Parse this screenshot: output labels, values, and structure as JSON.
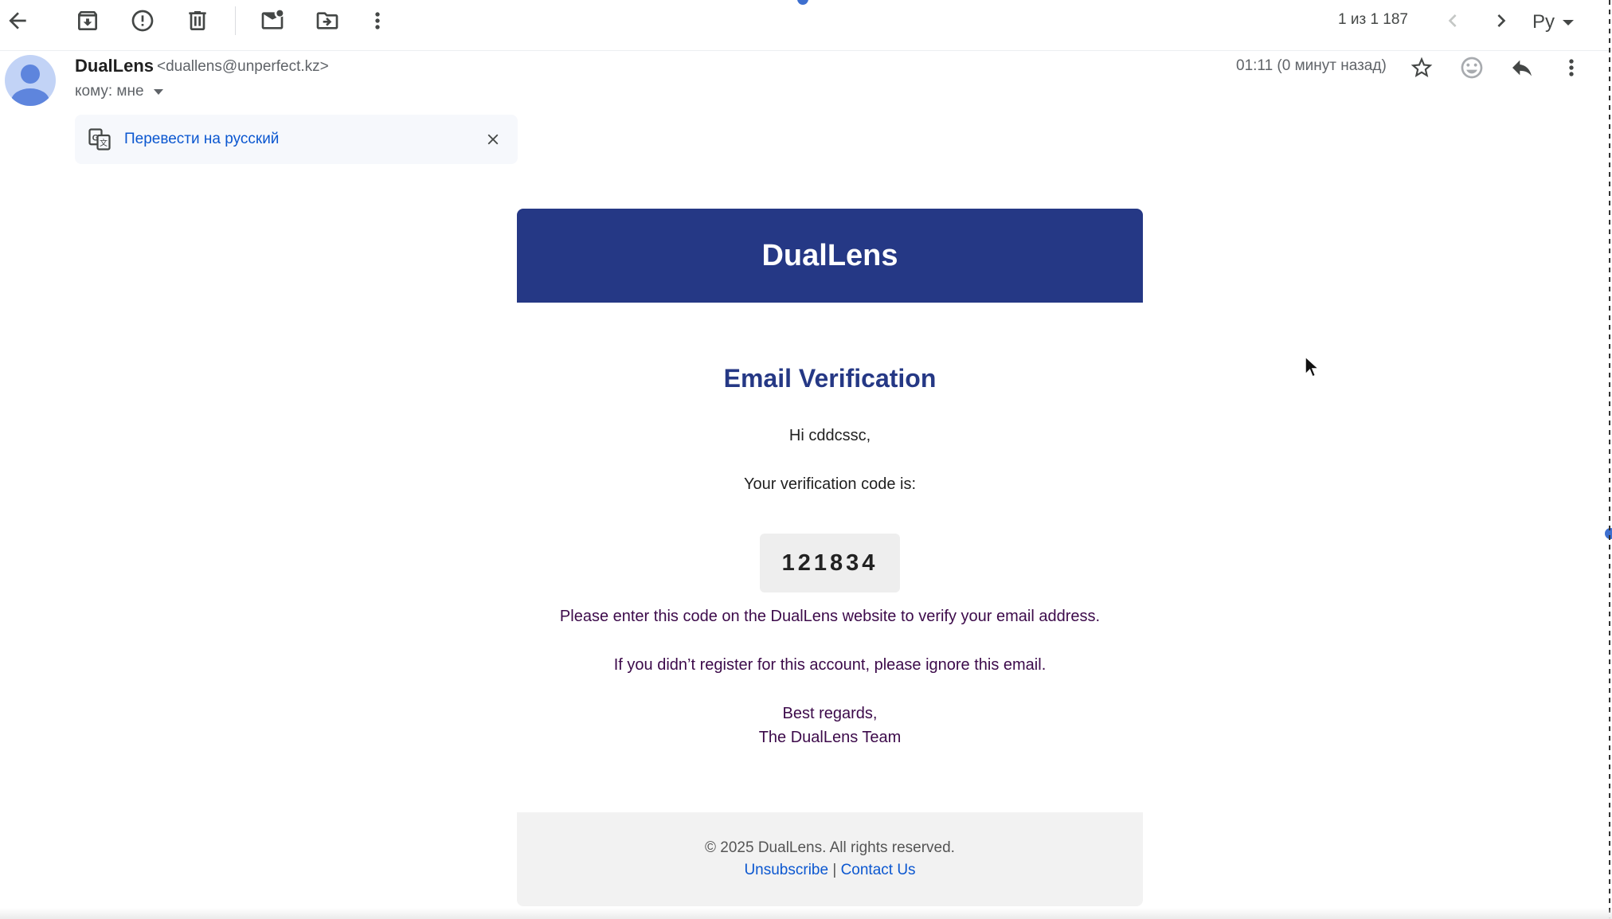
{
  "toolbar": {
    "back": "back-arrow-icon",
    "archive": "archive-icon",
    "spam": "report-spam-icon",
    "delete": "trash-icon",
    "mark_unread": "mark-unread-icon",
    "move": "move-to-icon",
    "more": "more-vert-icon",
    "pager_text": "1 из 1 187",
    "language_label": "Ру"
  },
  "message": {
    "sender_name": "DualLens",
    "sender_email": "<duallens@unperfect.kz>",
    "recipient_label": "кому: мне",
    "time": "01:11 (0 минут назад)"
  },
  "translate": {
    "link_text": "Перевести на русский"
  },
  "email": {
    "brand": "DualLens",
    "title": "Email Verification",
    "greeting": "Hi cddcssc,",
    "code_intro": "Your verification code is:",
    "code": "121834",
    "instruction": "Please enter this code on the DualLens website to verify your email address.",
    "ignore_note": "If you didn’t register for this account, please ignore this email.",
    "closing": "Best regards,",
    "signature": "The DualLens Team",
    "copyright": "© 2025 DualLens. All rights reserved.",
    "unsubscribe": "Unsubscribe",
    "separator": "|",
    "contact": "Contact Us"
  },
  "colors": {
    "brand_blue": "#253885",
    "link_blue": "#0b57d0",
    "body_purple": "#3c0a4a"
  }
}
